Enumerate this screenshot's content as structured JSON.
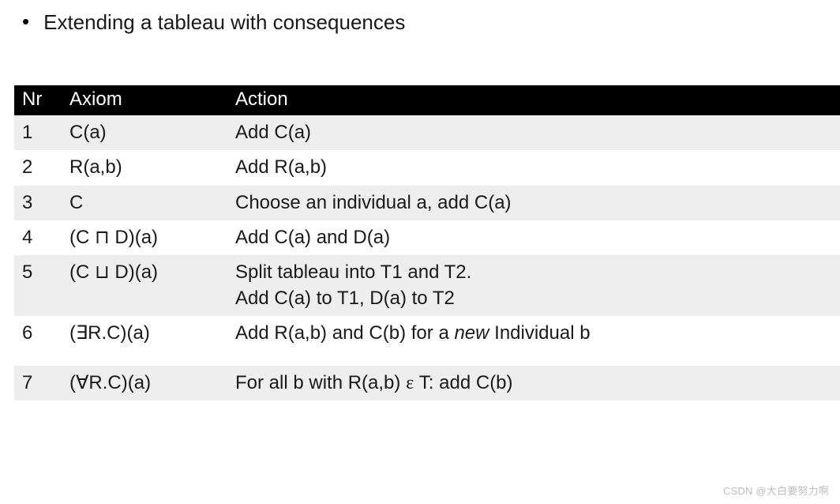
{
  "heading": "Extending a tableau with consequences",
  "bullet": "•",
  "columns": {
    "nr": "Nr",
    "axiom": "Axiom",
    "action": "Action"
  },
  "rows": [
    {
      "nr": "1",
      "axiom": "C(a)",
      "action_html": "Add C(a)"
    },
    {
      "nr": "2",
      "axiom": "R(a,b)",
      "action_html": "Add R(a,b)"
    },
    {
      "nr": "3",
      "axiom": "C",
      "action_html": "Choose an individual a, add C(a)"
    },
    {
      "nr": "4",
      "axiom": "(C ⊓ D)(a)",
      "action_html": "Add C(a) and D(a)"
    },
    {
      "nr": "5",
      "axiom": "(C ⊔ D)(a)",
      "action_html": "Split tableau into T1 and T2.<br>Add C(a) to T1, D(a) to T2"
    },
    {
      "nr": "6",
      "axiom": "(∃R.C)(a)",
      "action_html": "Add R(a,b) and C(b) for a <span class=\"italic\">new</span> Individual b"
    },
    {
      "nr": "7",
      "axiom": "(∀R.C)(a)",
      "action_html": "For all b with R(a,b) <span class=\"epsilon\">&epsilon;</span> T: add C(b)"
    }
  ],
  "watermark": "CSDN @大白要努力啊",
  "chart_data": {
    "type": "table",
    "title": "Extending a tableau with consequences",
    "columns": [
      "Nr",
      "Axiom",
      "Action"
    ],
    "rows": [
      [
        "1",
        "C(a)",
        "Add C(a)"
      ],
      [
        "2",
        "R(a,b)",
        "Add R(a,b)"
      ],
      [
        "3",
        "C",
        "Choose an individual a, add C(a)"
      ],
      [
        "4",
        "(C ⊓ D)(a)",
        "Add C(a) and D(a)"
      ],
      [
        "5",
        "(C ⊔ D)(a)",
        "Split tableau into T1 and T2. Add C(a) to T1, D(a) to T2"
      ],
      [
        "6",
        "(∃R.C)(a)",
        "Add R(a,b) and C(b) for a new Individual b"
      ],
      [
        "7",
        "(∀R.C)(a)",
        "For all b with R(a,b) ∈ T: add C(b)"
      ]
    ]
  }
}
